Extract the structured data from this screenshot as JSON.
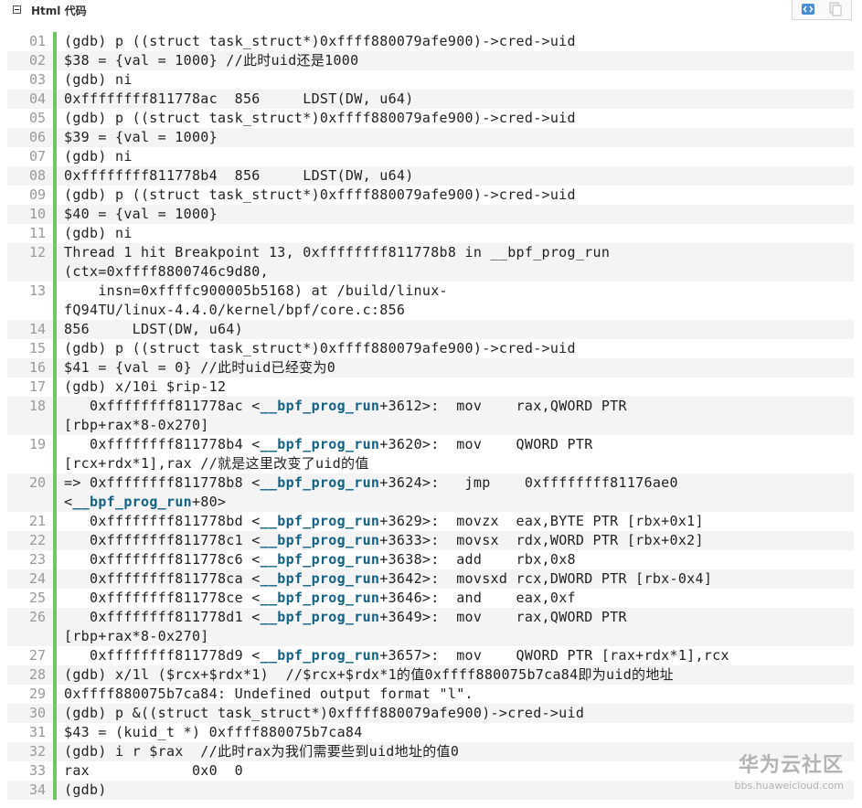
{
  "header": {
    "title": "Html 代码"
  },
  "toolbar": {
    "view_icon": "view-source-icon",
    "copy_icon": "copy-icon"
  },
  "colors": {
    "line_bar": "#6ec85f",
    "function_name": "#126286",
    "zebra": "#f4f4f4"
  },
  "code_lines": [
    {
      "num": "01",
      "rows": [
        [
          {
            "t": "(gdb) p ((struct task_struct*)0xffff880079afe900)->cred->uid"
          }
        ]
      ]
    },
    {
      "num": "02",
      "rows": [
        [
          {
            "t": "$38 = {val = 1000} //此时uid还是1000"
          }
        ]
      ]
    },
    {
      "num": "03",
      "rows": [
        [
          {
            "t": "(gdb) ni"
          }
        ]
      ]
    },
    {
      "num": "04",
      "rows": [
        [
          {
            "t": "0xffffffff811778ac  856     LDST(DW, u64)"
          }
        ]
      ]
    },
    {
      "num": "05",
      "rows": [
        [
          {
            "t": "(gdb) p ((struct task_struct*)0xffff880079afe900)->cred->uid"
          }
        ]
      ]
    },
    {
      "num": "06",
      "rows": [
        [
          {
            "t": "$39 = {val = 1000}"
          }
        ]
      ]
    },
    {
      "num": "07",
      "rows": [
        [
          {
            "t": "(gdb) ni"
          }
        ]
      ]
    },
    {
      "num": "08",
      "rows": [
        [
          {
            "t": "0xffffffff811778b4  856     LDST(DW, u64)"
          }
        ]
      ]
    },
    {
      "num": "09",
      "rows": [
        [
          {
            "t": "(gdb) p ((struct task_struct*)0xffff880079afe900)->cred->uid"
          }
        ]
      ]
    },
    {
      "num": "10",
      "rows": [
        [
          {
            "t": "$40 = {val = 1000}"
          }
        ]
      ]
    },
    {
      "num": "11",
      "rows": [
        [
          {
            "t": "(gdb) ni"
          }
        ]
      ]
    },
    {
      "num": "12",
      "rows": [
        [
          {
            "t": "Thread 1 hit Breakpoint 13, 0xffffffff811778b8 in __bpf_prog_run"
          }
        ],
        [
          {
            "t": "(ctx=0xffff8800746c9d80,"
          }
        ]
      ]
    },
    {
      "num": "13",
      "rows": [
        [
          {
            "t": "    insn=0xffffc900005b5168) at /build/linux-"
          }
        ],
        [
          {
            "t": "fQ94TU/linux-4.4.0/kernel/bpf/core.c:856"
          }
        ]
      ]
    },
    {
      "num": "14",
      "rows": [
        [
          {
            "t": "856     LDST(DW, u64)"
          }
        ]
      ]
    },
    {
      "num": "15",
      "rows": [
        [
          {
            "t": "(gdb) p ((struct task_struct*)0xffff880079afe900)->cred->uid"
          }
        ]
      ]
    },
    {
      "num": "16",
      "rows": [
        [
          {
            "t": "$41 = {val = 0} //此时uid已经变为0"
          }
        ]
      ]
    },
    {
      "num": "17",
      "rows": [
        [
          {
            "t": "(gdb) x/10i $rip-12"
          }
        ]
      ]
    },
    {
      "num": "18",
      "rows": [
        [
          {
            "t": "   0xffffffff811778ac <"
          },
          {
            "t": "__bpf_prog_run",
            "fn": true
          },
          {
            "t": "+3612>:  mov    rax,QWORD PTR"
          }
        ],
        [
          {
            "t": "[rbp+rax*8-0x270]"
          }
        ]
      ]
    },
    {
      "num": "19",
      "rows": [
        [
          {
            "t": "   0xffffffff811778b4 <"
          },
          {
            "t": "__bpf_prog_run",
            "fn": true
          },
          {
            "t": "+3620>:  mov    QWORD PTR"
          }
        ],
        [
          {
            "t": "[rcx+rdx*1],rax //就是这里改变了uid的值"
          }
        ]
      ]
    },
    {
      "num": "20",
      "rows": [
        [
          {
            "t": "=> 0xffffffff811778b8 <"
          },
          {
            "t": "__bpf_prog_run",
            "fn": true
          },
          {
            "t": "+3624>:   jmp    0xffffffff81176ae0"
          }
        ],
        [
          {
            "t": "<"
          },
          {
            "t": "__bpf_prog_run",
            "fn": true
          },
          {
            "t": "+80>"
          }
        ]
      ]
    },
    {
      "num": "21",
      "rows": [
        [
          {
            "t": "   0xffffffff811778bd <"
          },
          {
            "t": "__bpf_prog_run",
            "fn": true
          },
          {
            "t": "+3629>:  movzx  eax,BYTE PTR [rbx+0x1]"
          }
        ]
      ]
    },
    {
      "num": "22",
      "rows": [
        [
          {
            "t": "   0xffffffff811778c1 <"
          },
          {
            "t": "__bpf_prog_run",
            "fn": true
          },
          {
            "t": "+3633>:  movsx  rdx,WORD PTR [rbx+0x2]"
          }
        ]
      ]
    },
    {
      "num": "23",
      "rows": [
        [
          {
            "t": "   0xffffffff811778c6 <"
          },
          {
            "t": "__bpf_prog_run",
            "fn": true
          },
          {
            "t": "+3638>:  add    rbx,0x8"
          }
        ]
      ]
    },
    {
      "num": "24",
      "rows": [
        [
          {
            "t": "   0xffffffff811778ca <"
          },
          {
            "t": "__bpf_prog_run",
            "fn": true
          },
          {
            "t": "+3642>:  movsxd rcx,DWORD PTR [rbx-0x4]"
          }
        ]
      ]
    },
    {
      "num": "25",
      "rows": [
        [
          {
            "t": "   0xffffffff811778ce <"
          },
          {
            "t": "__bpf_prog_run",
            "fn": true
          },
          {
            "t": "+3646>:  and    eax,0xf"
          }
        ]
      ]
    },
    {
      "num": "26",
      "rows": [
        [
          {
            "t": "   0xffffffff811778d1 <"
          },
          {
            "t": "__bpf_prog_run",
            "fn": true
          },
          {
            "t": "+3649>:  mov    rax,QWORD PTR"
          }
        ],
        [
          {
            "t": "[rbp+rax*8-0x270]"
          }
        ]
      ]
    },
    {
      "num": "27",
      "rows": [
        [
          {
            "t": "   0xffffffff811778d9 <"
          },
          {
            "t": "__bpf_prog_run",
            "fn": true
          },
          {
            "t": "+3657>:  mov    QWORD PTR [rax+rdx*1],rcx"
          }
        ]
      ]
    },
    {
      "num": "28",
      "rows": [
        [
          {
            "t": "(gdb) x/1l ($rcx+$rdx*1)  //$rcx+$rdx*1的值0xffff880075b7ca84即为uid的地址"
          }
        ]
      ]
    },
    {
      "num": "29",
      "rows": [
        [
          {
            "t": "0xffff880075b7ca84: Undefined output format \"l\"."
          }
        ]
      ]
    },
    {
      "num": "30",
      "rows": [
        [
          {
            "t": "(gdb) p &((struct task_struct*)0xffff880079afe900)->cred->uid"
          }
        ]
      ]
    },
    {
      "num": "31",
      "rows": [
        [
          {
            "t": "$43 = (kuid_t *) 0xffff880075b7ca84"
          }
        ]
      ]
    },
    {
      "num": "32",
      "rows": [
        [
          {
            "t": "(gdb) i r $rax  //此时rax为我们需要些到uid地址的值0"
          }
        ]
      ]
    },
    {
      "num": "33",
      "rows": [
        [
          {
            "t": "rax            0x0  0"
          }
        ]
      ]
    },
    {
      "num": "34",
      "rows": [
        [
          {
            "t": "(gdb)"
          }
        ]
      ]
    }
  ],
  "watermark": {
    "title": "华为云社区",
    "url": "bbs.huaweicloud.com"
  }
}
